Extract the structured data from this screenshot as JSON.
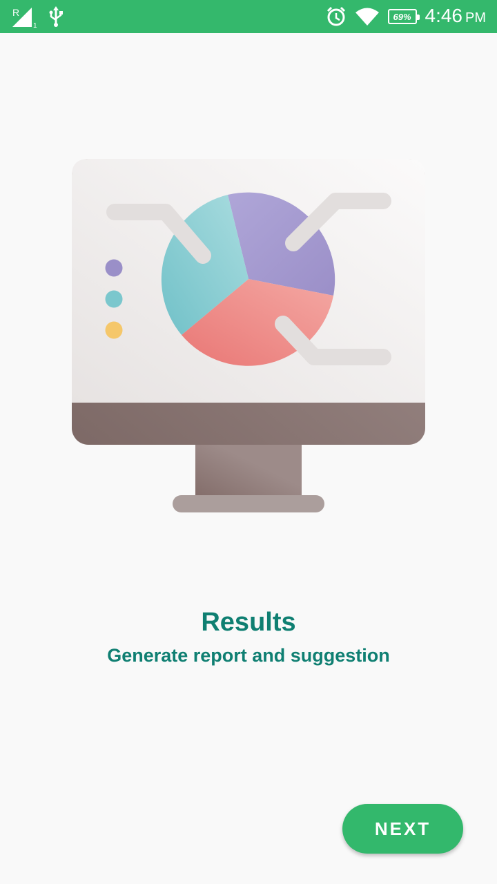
{
  "status_bar": {
    "sim_label": "R",
    "sim_slot": "1",
    "battery": "69%",
    "time": "4:46",
    "ampm": "PM",
    "icons": [
      "signal-icon",
      "usb-icon",
      "alarm-icon",
      "wifi-icon",
      "battery-icon"
    ]
  },
  "onboarding": {
    "title": "Results",
    "subtitle": "Generate report and suggestion",
    "next_label": "NEXT"
  },
  "illustration": {
    "name": "monitor-pie-chart-illustration",
    "colors": {
      "purple": "#9d92c9",
      "teal": "#7dcad0",
      "red": "#ef8683",
      "yellow": "#f4c86a",
      "screen": "#efeded",
      "stand": "#8c7672"
    }
  },
  "colors": {
    "accent": "#34b86c",
    "title": "#0f7f72",
    "background": "#f9f9f9"
  }
}
